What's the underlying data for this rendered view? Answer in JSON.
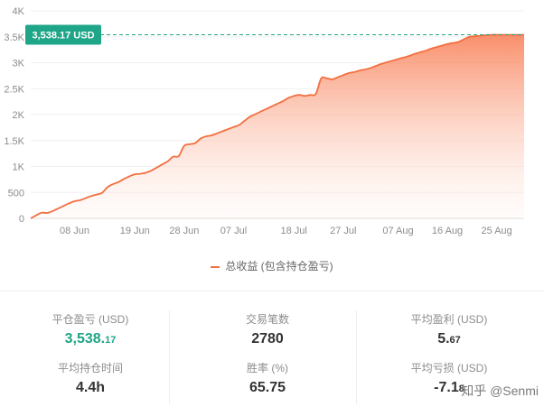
{
  "chart_data": {
    "type": "area",
    "series": [
      {
        "name": "总收益 (包含持仓盈亏)",
        "color": "#f26f3f",
        "x": [
          0,
          1,
          2,
          3,
          4,
          5,
          6,
          7,
          8,
          9,
          10,
          11,
          12,
          13,
          14,
          15,
          16,
          17,
          18,
          19,
          20,
          21,
          22,
          23,
          24,
          25,
          26,
          27,
          28,
          29,
          30,
          31,
          32,
          33,
          34,
          35,
          36,
          37,
          38,
          39,
          40,
          41,
          42,
          43,
          44,
          45,
          46,
          47,
          48,
          49,
          50,
          51,
          52,
          53,
          54,
          55,
          56,
          57,
          58,
          59,
          60,
          61,
          62,
          63,
          64,
          65,
          66,
          67,
          68,
          69,
          70,
          71,
          72,
          73,
          74,
          75,
          76,
          77,
          78,
          79,
          80,
          81,
          82,
          83,
          84,
          85,
          86,
          87,
          88,
          89,
          90
        ],
        "y": [
          0,
          60,
          110,
          105,
          140,
          190,
          240,
          290,
          330,
          350,
          390,
          430,
          460,
          490,
          600,
          660,
          700,
          760,
          810,
          850,
          860,
          880,
          920,
          980,
          1040,
          1100,
          1190,
          1200,
          1400,
          1430,
          1450,
          1540,
          1580,
          1600,
          1640,
          1680,
          1720,
          1760,
          1800,
          1880,
          1960,
          2010,
          2060,
          2110,
          2160,
          2210,
          2260,
          2320,
          2360,
          2380,
          2360,
          2380,
          2400,
          2700,
          2700,
          2680,
          2720,
          2760,
          2800,
          2820,
          2850,
          2870,
          2900,
          2940,
          2980,
          3010,
          3040,
          3070,
          3100,
          3130,
          3170,
          3200,
          3230,
          3270,
          3300,
          3330,
          3360,
          3380,
          3400,
          3450,
          3500,
          3510,
          3520,
          3530,
          3538.17,
          3538.17,
          3538.17,
          3538.17,
          3538.17,
          3538.17,
          3538.17
        ]
      }
    ],
    "x_ticks": [
      {
        "x": 8,
        "label": "08 Jun"
      },
      {
        "x": 19,
        "label": "19 Jun"
      },
      {
        "x": 28,
        "label": "28 Jun"
      },
      {
        "x": 37,
        "label": "07 Jul"
      },
      {
        "x": 48,
        "label": "18 Jul"
      },
      {
        "x": 57,
        "label": "27 Jul"
      },
      {
        "x": 67,
        "label": "07 Aug"
      },
      {
        "x": 76,
        "label": "16 Aug"
      },
      {
        "x": 85,
        "label": "25 Aug"
      }
    ],
    "y_ticks": [
      {
        "v": 0,
        "label": "0"
      },
      {
        "v": 500,
        "label": "500"
      },
      {
        "v": 1000,
        "label": "1K"
      },
      {
        "v": 1500,
        "label": "1.5K"
      },
      {
        "v": 2000,
        "label": "2K"
      },
      {
        "v": 2500,
        "label": "2.5K"
      },
      {
        "v": 3000,
        "label": "3K"
      },
      {
        "v": 3500,
        "label": "3.5K"
      },
      {
        "v": 4000,
        "label": "4K"
      }
    ],
    "ylim": [
      0,
      4000
    ],
    "grid": true,
    "marker": {
      "value": 3538.17,
      "label": "3,538.17 USD",
      "color": "#1fa588"
    },
    "legend_position": "bottom"
  },
  "stats": [
    {
      "label": "平仓盈亏 (USD)",
      "int": "3,538.",
      "dec": "17",
      "color": "green"
    },
    {
      "label": "交易笔数",
      "int": "2780",
      "dec": ""
    },
    {
      "label": "平均盈利 (USD)",
      "int": "5.",
      "dec": "67"
    },
    {
      "label": "平均持仓时间",
      "int": "4.4h",
      "dec": ""
    },
    {
      "label": "胜率 (%)",
      "int": "65.75",
      "dec": ""
    },
    {
      "label": "平均亏损 (USD)",
      "int": "-7.1",
      "dec": "8"
    }
  ],
  "watermark": "知乎 @Senmi"
}
